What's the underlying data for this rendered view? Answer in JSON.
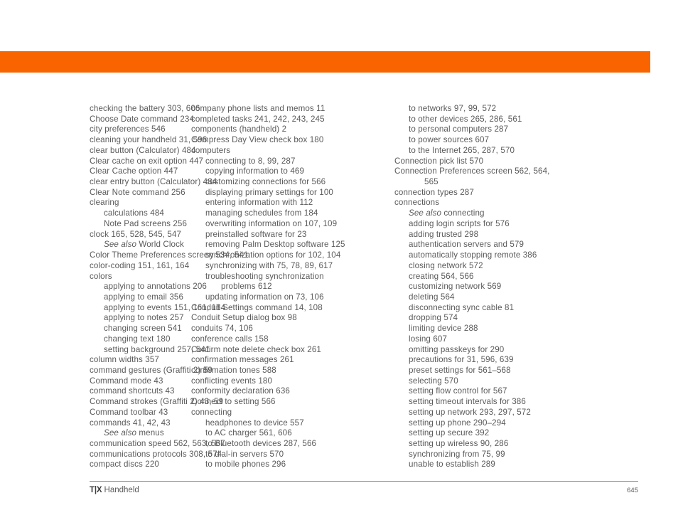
{
  "document": {
    "type": "index-page",
    "accent_color": "#fa6400",
    "text_color": "#5a5a5a",
    "rule_color": "#8c8c8c"
  },
  "footer": {
    "brand": "T|X",
    "product": "Handheld",
    "page_number": "645"
  },
  "columns": [
    {
      "id": "column-1",
      "entries": [
        {
          "level": 0,
          "text": "checking the battery 303, 606"
        },
        {
          "level": 0,
          "text": "Choose Date command 234"
        },
        {
          "level": 0,
          "text": "city preferences 546"
        },
        {
          "level": 0,
          "text": "cleaning your handheld 31, 596"
        },
        {
          "level": 0,
          "text": "clear button (Calculator) 484"
        },
        {
          "level": 0,
          "text": "Clear cache on exit option 447"
        },
        {
          "level": 0,
          "text": "Clear Cache option 447"
        },
        {
          "level": 0,
          "text": "clear entry button (Calculator) 484"
        },
        {
          "level": 0,
          "text": "Clear Note command 256"
        },
        {
          "level": 0,
          "text": "clearing"
        },
        {
          "level": 1,
          "text": "calculations 484"
        },
        {
          "level": 1,
          "text": "Note Pad screens 256"
        },
        {
          "level": 0,
          "text": "clock 165, 528, 545, 547"
        },
        {
          "level": 1,
          "italic_prefix": "See also",
          "text": " World Clock"
        },
        {
          "level": 0,
          "text": "Color Theme Preferences screen 534, 541"
        },
        {
          "level": 0,
          "text": "color-coding 151, 161, 164"
        },
        {
          "level": 0,
          "text": "colors"
        },
        {
          "level": 1,
          "text": "applying to annotations 206"
        },
        {
          "level": 1,
          "text": "applying to email 356"
        },
        {
          "level": 1,
          "text": "applying to events 151, 161, 164"
        },
        {
          "level": 1,
          "text": "applying to notes 257"
        },
        {
          "level": 1,
          "text": "changing screen 541"
        },
        {
          "level": 1,
          "text": "changing text 180"
        },
        {
          "level": 1,
          "text": "setting background 257, 541"
        },
        {
          "level": 0,
          "text": "column widths 357"
        },
        {
          "level": 0,
          "text": "command gestures (Graffiti 2) 59"
        },
        {
          "level": 0,
          "text": "Command mode 43"
        },
        {
          "level": 0,
          "text": "command shortcuts 43"
        },
        {
          "level": 0,
          "text": "Command strokes (Graffiti 2) 43, 59"
        },
        {
          "level": 0,
          "text": "Command toolbar 43"
        },
        {
          "level": 0,
          "text": "commands 41, 42, 43"
        },
        {
          "level": 1,
          "italic_prefix": "See also",
          "text": " menus"
        },
        {
          "level": 0,
          "text": "communication speed 562, 563, 567"
        },
        {
          "level": 0,
          "text": "communications protocols 308, 574"
        },
        {
          "level": 0,
          "text": "compact discs 220"
        }
      ]
    },
    {
      "id": "column-2",
      "entries": [
        {
          "level": 0,
          "text": "company phone lists and memos 11"
        },
        {
          "level": 0,
          "text": "completed tasks 241, 242, 243, 245"
        },
        {
          "level": 0,
          "text": "components (handheld) 2"
        },
        {
          "level": 0,
          "text": "Compress Day View check box 180"
        },
        {
          "level": 0,
          "text": "computers"
        },
        {
          "level": 1,
          "text": "connecting to 8, 99, 287"
        },
        {
          "level": 1,
          "text": "copying information to 469"
        },
        {
          "level": 1,
          "text": "customizing connections for 566"
        },
        {
          "level": 1,
          "text": "displaying primary settings for 100"
        },
        {
          "level": 1,
          "text": "entering information with 112"
        },
        {
          "level": 1,
          "text": "managing schedules from 184"
        },
        {
          "level": 1,
          "text": "overwriting information on 107, 109"
        },
        {
          "level": 1,
          "text": "preinstalled software for 23"
        },
        {
          "level": 1,
          "text": "removing Palm Desktop software 125"
        },
        {
          "level": 1,
          "text": "synchronization options for 102, 104"
        },
        {
          "level": 1,
          "text": "synchronizing with 75, 78, 89, 617"
        },
        {
          "level": 1,
          "text": "troubleshooting synchronization"
        },
        {
          "level": 2,
          "text": "problems 612"
        },
        {
          "level": 1,
          "text": "updating information on 73, 106"
        },
        {
          "level": 0,
          "text": "Conduit Settings command 14, 108"
        },
        {
          "level": 0,
          "text": "Conduit Setup dialog box 98"
        },
        {
          "level": 0,
          "text": "conduits 74, 106"
        },
        {
          "level": 0,
          "text": "conference calls 158"
        },
        {
          "level": 0,
          "text": "Confirm note delete check box 261"
        },
        {
          "level": 0,
          "text": "confirmation messages 261"
        },
        {
          "level": 0,
          "text": "confirmation tones 588"
        },
        {
          "level": 0,
          "text": "conflicting events 180"
        },
        {
          "level": 0,
          "text": "conformity declaration 636"
        },
        {
          "level": 0,
          "text": "Connect to setting 566"
        },
        {
          "level": 0,
          "text": "connecting"
        },
        {
          "level": 1,
          "text": "headphones to device 557"
        },
        {
          "level": 1,
          "text": "to AC charger 561, 606"
        },
        {
          "level": 1,
          "text": "to Bluetooth devices 287, 566"
        },
        {
          "level": 1,
          "text": "to dial-in servers 570"
        },
        {
          "level": 1,
          "text": "to mobile phones 296"
        }
      ]
    },
    {
      "id": "column-3",
      "entries": [
        {
          "level": 1,
          "text": "to networks 97, 99, 572"
        },
        {
          "level": 1,
          "text": "to other devices 265, 286, 561"
        },
        {
          "level": 1,
          "text": "to personal computers 287"
        },
        {
          "level": 1,
          "text": "to power sources 607"
        },
        {
          "level": 1,
          "text": "to the Internet 265, 287, 570"
        },
        {
          "level": 0,
          "text": "Connection pick list 570"
        },
        {
          "level": 0,
          "text": "Connection Preferences screen 562, 564,"
        },
        {
          "level": 2,
          "text": "565"
        },
        {
          "level": 0,
          "text": "connection types 287"
        },
        {
          "level": 0,
          "text": "connections"
        },
        {
          "level": 1,
          "italic_prefix": "See also",
          "text": " connecting"
        },
        {
          "level": 1,
          "text": "adding login scripts for 576"
        },
        {
          "level": 1,
          "text": "adding trusted 298"
        },
        {
          "level": 1,
          "text": "authentication servers and 579"
        },
        {
          "level": 1,
          "text": "automatically stopping remote 386"
        },
        {
          "level": 1,
          "text": "closing network 572"
        },
        {
          "level": 1,
          "text": "creating 564, 566"
        },
        {
          "level": 1,
          "text": "customizing network 569"
        },
        {
          "level": 1,
          "text": "deleting 564"
        },
        {
          "level": 1,
          "text": "disconnecting sync cable 81"
        },
        {
          "level": 1,
          "text": "dropping 574"
        },
        {
          "level": 1,
          "text": "limiting device 288"
        },
        {
          "level": 1,
          "text": "losing 607"
        },
        {
          "level": 1,
          "text": "omitting passkeys for 290"
        },
        {
          "level": 1,
          "text": "precautions for 31, 596, 639"
        },
        {
          "level": 1,
          "text": "preset settings for 561–568"
        },
        {
          "level": 1,
          "text": "selecting 570"
        },
        {
          "level": 1,
          "text": "setting flow control for 567"
        },
        {
          "level": 1,
          "text": "setting timeout intervals for 386"
        },
        {
          "level": 1,
          "text": "setting up network 293, 297, 572"
        },
        {
          "level": 1,
          "text": "setting up phone 290–294"
        },
        {
          "level": 1,
          "text": "setting up secure 392"
        },
        {
          "level": 1,
          "text": "setting up wireless 90, 286"
        },
        {
          "level": 1,
          "text": "synchronizing from 75, 99"
        },
        {
          "level": 1,
          "text": "unable to establish 289"
        }
      ]
    }
  ]
}
